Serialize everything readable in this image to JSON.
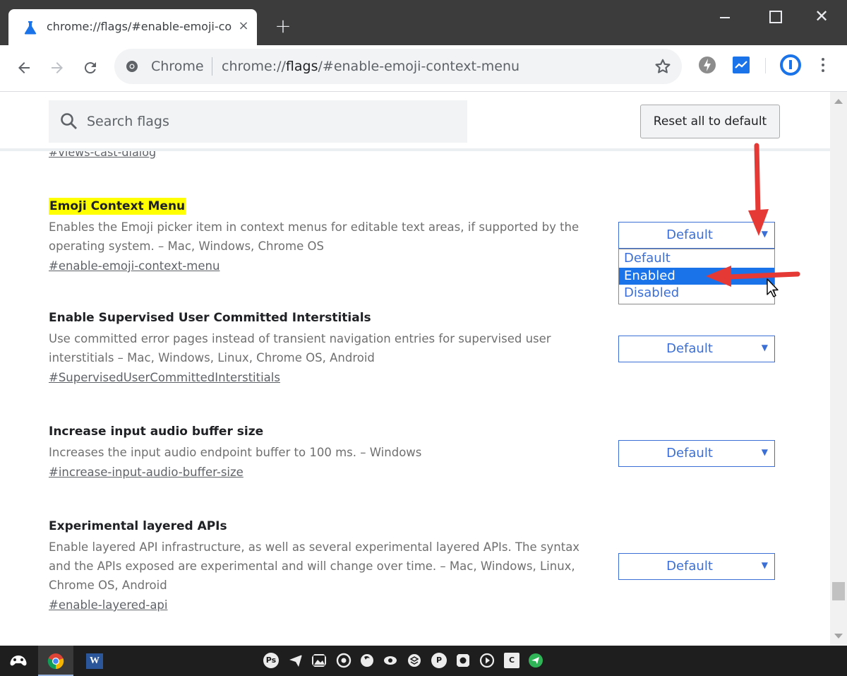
{
  "browser": {
    "tab": {
      "title": "chrome://flags/#enable-emoji-co",
      "close_glyph": "×",
      "favicon": "flask-icon"
    },
    "new_tab_glyph": "+",
    "window_controls": {
      "close_glyph": "✕"
    },
    "omnibox": {
      "scheme_label": "Chrome",
      "url_prefix": "chrome://",
      "url_host": "flags",
      "url_suffix": "/#enable-emoji-context-menu"
    }
  },
  "flags_page": {
    "search": {
      "placeholder": "Search flags"
    },
    "reset_button": "Reset all to default",
    "previous_link": "#views-cast-dialog",
    "flags": [
      {
        "title": "Emoji Context Menu",
        "description": "Enables the Emoji picker item in context menus for editable text areas, if supported by the operating system. – Mac, Windows, Chrome OS",
        "link": "#enable-emoji-context-menu",
        "value": "Default",
        "highlighted": true,
        "dropdown_open": true
      },
      {
        "title": "Enable Supervised User Committed Interstitials",
        "description": "Use committed error pages instead of transient navigation entries for supervised user interstitials – Mac, Windows, Linux, Chrome OS, Android",
        "link": "#SupervisedUserCommittedInterstitials",
        "value": "Default"
      },
      {
        "title": "Increase input audio buffer size",
        "description": "Increases the input audio endpoint buffer to 100 ms. – Windows",
        "link": "#increase-input-audio-buffer-size",
        "value": "Default"
      },
      {
        "title": "Experimental layered APIs",
        "description": "Enable layered API infrastructure, as well as several experimental layered APIs. The syntax and the APIs exposed are experimental and will change over time. – Mac, Windows, Linux, Chrome OS, Android",
        "link": "#enable-layered-api",
        "value": "Default"
      }
    ],
    "dropdown_options": [
      "Default",
      "Enabled",
      "Disabled"
    ],
    "dropdown_selected": "Enabled",
    "select_arrow_glyph": "▼"
  },
  "taskbar": {
    "word_label": "W",
    "tray_labels": [
      "Ps",
      "P",
      "C"
    ]
  },
  "colors": {
    "highlight": "#ffff00",
    "select_blue": "#3b6fd6",
    "option_selected_bg": "#1a73e8",
    "annotation_red": "#e53935"
  }
}
